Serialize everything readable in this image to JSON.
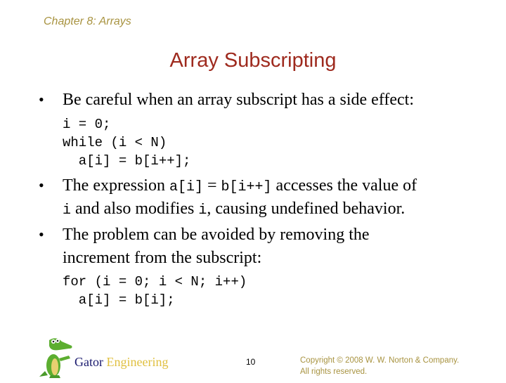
{
  "header": {
    "chapter": "Chapter 8: Arrays",
    "title": "Array Subscripting"
  },
  "bullets": [
    {
      "text": "Be careful when an array subscript has a side effect:"
    },
    {
      "line1_pre": "The expression ",
      "line1_code1": "a[i]",
      "line1_mid": " = ",
      "line1_code2": "b[i++]",
      "line1_post": " accesses the value of",
      "line2_code1": "i",
      "line2_mid": " and also modifies ",
      "line2_code2": "i",
      "line2_post": ", causing undefined behavior."
    },
    {
      "line1": "The problem can be avoided by removing the",
      "line2": "increment from the subscript:"
    }
  ],
  "code_blocks": [
    [
      "i = 0;",
      "while (i < N)",
      "  a[i] = b[i++];"
    ],
    [
      "for (i = 0; i < N; i++)",
      "  a[i] = b[i];"
    ]
  ],
  "footer": {
    "brand_word1": "Gator",
    "brand_word2": "Engineering",
    "page_number": "10",
    "copyright_line1": "Copyright © 2008 W. W. Norton & Company.",
    "copyright_line2": "All rights reserved."
  },
  "icons": {
    "mascot": "gator-mascot-icon",
    "bullet": "bullet-dot"
  }
}
